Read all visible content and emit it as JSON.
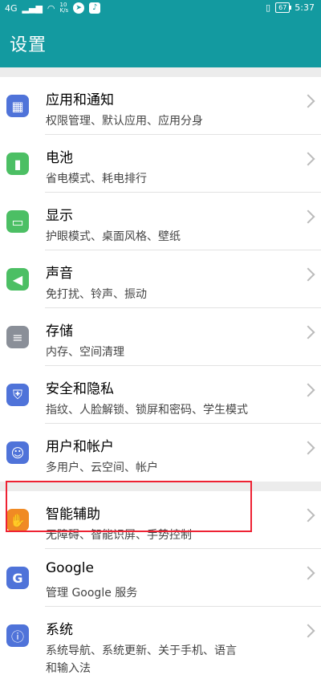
{
  "status": {
    "network": "4G",
    "speed_value": "10",
    "speed_unit": "K/s",
    "battery": "67",
    "time": "5:37"
  },
  "header": {
    "title": "设置"
  },
  "colors": {
    "accent": "#139aa0",
    "highlight": "#e23"
  },
  "items": [
    {
      "title": "应用和通知",
      "subtitle": "权限管理、默认应用、应用分身",
      "icon": "apps-grid-icon",
      "icon_color": "#4f73d9"
    },
    {
      "title": "电池",
      "subtitle": "省电模式、耗电排行",
      "icon": "battery-icon",
      "icon_color": "#4cbf64"
    },
    {
      "title": "显示",
      "subtitle": "护眼模式、桌面风格、壁纸",
      "icon": "display-icon",
      "icon_color": "#4cbf64"
    },
    {
      "title": "声音",
      "subtitle": "免打扰、铃声、振动",
      "icon": "speaker-icon",
      "icon_color": "#4cbf64"
    },
    {
      "title": "存储",
      "subtitle": "内存、空间清理",
      "icon": "storage-icon",
      "icon_color": "#8a8f98"
    },
    {
      "title": "安全和隐私",
      "subtitle": "指纹、人脸解锁、锁屏和密码、学生模式",
      "icon": "shield-icon",
      "icon_color": "#4f73d9"
    },
    {
      "title": "用户和帐户",
      "subtitle": "多用户、云空间、帐户",
      "icon": "user-icon",
      "icon_color": "#4f73d9"
    },
    {
      "title": "智能辅助",
      "subtitle": "无障碍、智能识屏、手势控制",
      "icon": "hand-icon",
      "icon_color": "#f08a24"
    },
    {
      "title": "Google",
      "subtitle": "管理 Google 服务",
      "icon": "google-icon",
      "icon_color": "#4f73d9"
    },
    {
      "title": "系统",
      "subtitle": "系统导航、系统更新、关于手机、语言",
      "subtitle2": "和输入法",
      "icon": "system-icon",
      "icon_color": "#4f73d9"
    }
  ]
}
